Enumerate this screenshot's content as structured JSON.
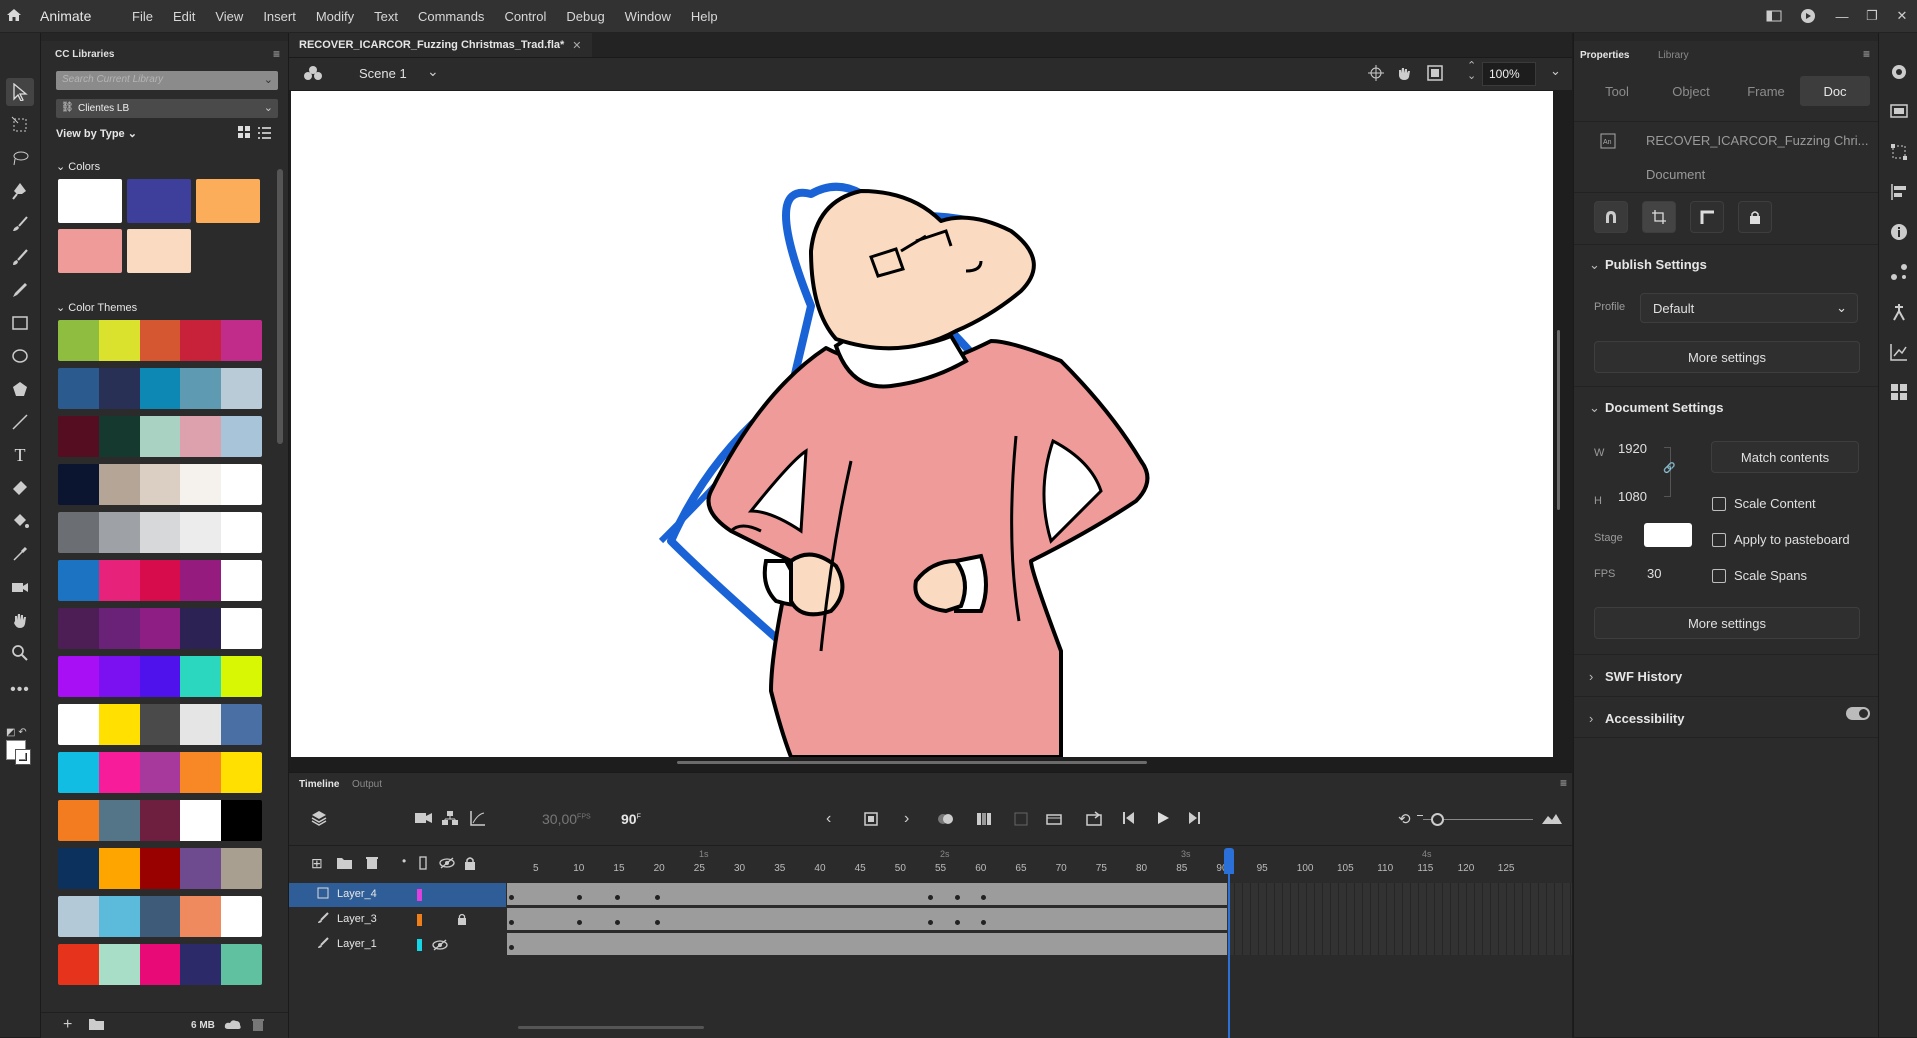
{
  "app": {
    "name": "Animate"
  },
  "menu": [
    "File",
    "Edit",
    "View",
    "Insert",
    "Modify",
    "Text",
    "Commands",
    "Control",
    "Debug",
    "Window",
    "Help"
  ],
  "libraries": {
    "title": "CC Libraries",
    "search_placeholder": "Search Current Library",
    "library_name": "Clientes LB",
    "view_by": "View by Type",
    "colors_header": "Colors",
    "colors": [
      "#ffffff",
      "#3d3f9b",
      "#fcad5a",
      "#ee9b9a",
      "#fadbc2"
    ],
    "themes_header": "Color Themes",
    "themes": [
      [
        "#8ebd3f",
        "#dbe22d",
        "#d45731",
        "#c8223a",
        "#c12c8a"
      ],
      [
        "#2b5b8e",
        "#293056",
        "#0d87b4",
        "#5f9ab3",
        "#b9cbd6"
      ],
      [
        "#550d22",
        "#16392f",
        "#a9d2c3",
        "#dca1ac",
        "#a7c4d9"
      ],
      [
        "#0b1530",
        "#b5a596",
        "#dbcfc3",
        "#f5f1ec",
        "#ffffff"
      ],
      [
        "#6b6f73",
        "#9ea2a6",
        "#d6d8da",
        "#ececec",
        "#ffffff"
      ],
      [
        "#1c73c2",
        "#e7227b",
        "#d70c4c",
        "#961b7f",
        "#ffffff"
      ],
      [
        "#4d1e56",
        "#6a2278",
        "#8e1e84",
        "#2c2254",
        "#ffffff"
      ],
      [
        "#a80ff5",
        "#7b11f0",
        "#4f12ec",
        "#2cd7bf",
        "#d7f705"
      ],
      [
        "#ffffff",
        "#ffe000",
        "#4a4a4a",
        "#e5e5e5",
        "#4a6fa5"
      ],
      [
        "#12bde3",
        "#f71d9a",
        "#a8399c",
        "#f78825",
        "#ffe000"
      ],
      [
        "#f47c20",
        "#547587",
        "#6e1f3f",
        "#ffffff",
        "#000000"
      ],
      [
        "#0b315c",
        "#ffa500",
        "#990000",
        "#6e4a8e",
        "#a89f91"
      ],
      [
        "#b4c9d8",
        "#5cbadb",
        "#3f5b7a",
        "#ee8a5e",
        "#ffffff"
      ],
      [
        "#e6341c",
        "#a8ddc7",
        "#e80a77",
        "#2d2a6a",
        "#5fc1a0"
      ]
    ],
    "footer_size": "6 MB"
  },
  "document": {
    "tab_title": "RECOVER_ICARCOR_Fuzzing Christmas_Trad.fla*",
    "scene": "Scene 1",
    "zoom": "100%"
  },
  "timeline": {
    "tabs": [
      "Timeline",
      "Output"
    ],
    "fps": "30,00",
    "fps_unit": "FPS",
    "frame": "90",
    "frame_unit": "F",
    "second_markers": [
      "1s",
      "2s",
      "3s",
      "4s"
    ],
    "ruler": [
      "5",
      "10",
      "15",
      "20",
      "25",
      "30",
      "35",
      "40",
      "45",
      "50",
      "55",
      "60",
      "65",
      "70",
      "75",
      "80",
      "85",
      "90",
      "95",
      "100",
      "105",
      "110",
      "115",
      "120",
      "125"
    ],
    "layers": [
      {
        "name": "Layer_4",
        "color": "#e040e0",
        "selected": true,
        "locked": false,
        "hidden": false
      },
      {
        "name": "Layer_3",
        "color": "#f07f1a",
        "selected": false,
        "locked": true,
        "hidden": false
      },
      {
        "name": "Layer_1",
        "color": "#14d6e6",
        "selected": false,
        "locked": false,
        "hidden": true
      }
    ]
  },
  "properties": {
    "tabs_top": [
      "Properties",
      "Library"
    ],
    "tabs": [
      "Tool",
      "Object",
      "Frame",
      "Doc"
    ],
    "doc_name": "RECOVER_ICARCOR_Fuzzing Chri...",
    "doc_type": "Document",
    "publish_header": "Publish Settings",
    "profile_label": "Profile",
    "profile_value": "Default",
    "more_settings": "More settings",
    "doc_header": "Document Settings",
    "w_label": "W",
    "w_value": "1920",
    "h_label": "H",
    "h_value": "1080",
    "match_contents": "Match contents",
    "scale_content": "Scale Content",
    "stage_label": "Stage",
    "apply_pasteboard": "Apply to pasteboard",
    "fps_label": "FPS",
    "fps_value": "30",
    "scale_spans": "Scale Spans",
    "more_settings2": "More settings",
    "swf_history": "SWF History",
    "accessibility": "Accessibility"
  }
}
